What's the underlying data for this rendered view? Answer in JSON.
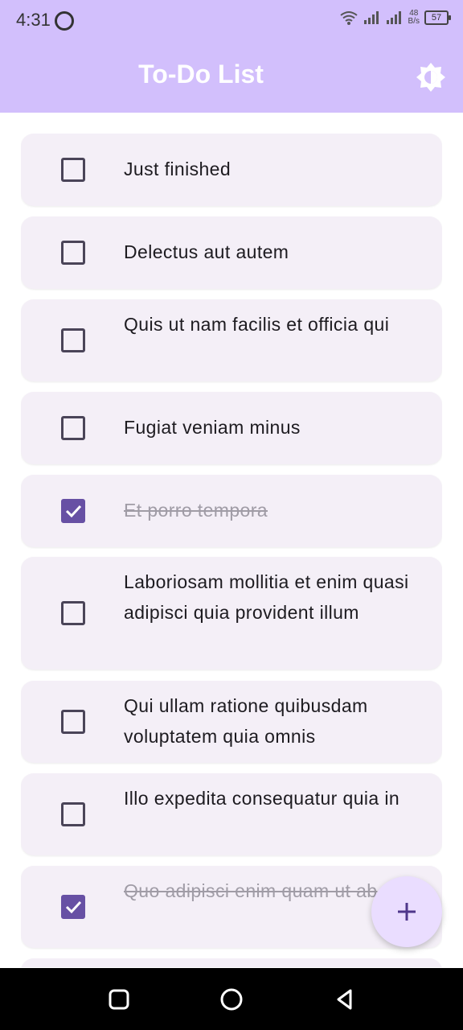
{
  "status_bar": {
    "time": "4:31",
    "net_speed_value": "48",
    "net_speed_unit": "B/s",
    "battery": "57"
  },
  "app_bar": {
    "title": "To-Do List",
    "theme_icon": "brightness-icon"
  },
  "todos": [
    {
      "title": "Just finished",
      "done": false
    },
    {
      "title": "Delectus aut autem",
      "done": false
    },
    {
      "title": "Quis ut nam facilis et officia qui",
      "done": false
    },
    {
      "title": "Fugiat veniam minus",
      "done": false
    },
    {
      "title": "Et porro tempora",
      "done": true
    },
    {
      "title": "Laboriosam mollitia et enim quasi adipisci quia provident illum",
      "done": false
    },
    {
      "title": "Qui ullam ratione quibusdam voluptatem quia omnis",
      "done": false
    },
    {
      "title": "Illo expedita consequatur quia in",
      "done": false
    },
    {
      "title": "Quo adipisci enim quam ut ab",
      "done": true
    }
  ],
  "fab": {
    "icon": "plus-icon"
  },
  "colors": {
    "app_bar": "#d2bffc",
    "card": "#f4eff7",
    "checkbox_checked": "#6750a4",
    "fab": "#eaddff"
  }
}
